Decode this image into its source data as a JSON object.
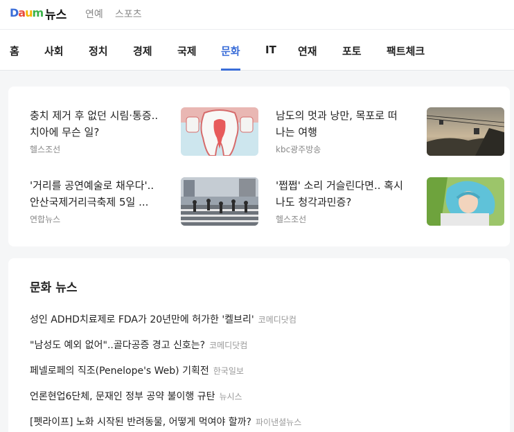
{
  "header": {
    "logo_text": "Daum",
    "service_name": "뉴스",
    "links": [
      "연예",
      "스포츠"
    ]
  },
  "nav": {
    "items": [
      "홈",
      "사회",
      "정치",
      "경제",
      "국제",
      "문화",
      "IT",
      "연재",
      "포토",
      "팩트체크"
    ],
    "active": "문화",
    "accent_color": "#3a6dd8"
  },
  "featured": [
    {
      "title_line1": "충치 제거 후 없던 시림·통증..",
      "title_line2": "치아에 무슨 일?",
      "source": "헬스조선",
      "thumb_icon": "tooth-illustration"
    },
    {
      "title_line1": "남도의 멋과 낭만, 목포로 떠",
      "title_line2": "나는 여행",
      "source": "kbc광주방송",
      "thumb_icon": "cable-car-photo"
    },
    {
      "title_line1": "'거리를 공연예술로 채우다'..",
      "title_line2": "안산국제거리극축제 5일 ...",
      "source": "연합뉴스",
      "thumb_icon": "street-crowd-photo"
    },
    {
      "title_line1": "'쩝쩝' 소리 거슬린다면.. 혹시",
      "title_line2": "나도 청각과민증?",
      "source": "헬스조선",
      "thumb_icon": "woman-covering-ears-photo"
    }
  ],
  "culture_news": {
    "title": "문화 뉴스",
    "items": [
      {
        "headline": "성인 ADHD치료제로 FDA가 20년만에 허가한 '켈브리'",
        "source": "코메디닷컴"
      },
      {
        "headline": "\"남성도 예외 없어\"..골다공증 경고 신호는?",
        "source": "코메디닷컴"
      },
      {
        "headline": "페넬로페의 직조(Penelope's Web) 기획전",
        "source": "한국일보"
      },
      {
        "headline": "언론현업6단체, 문재인 정부 공약 불이행 규탄",
        "source": "뉴시스"
      },
      {
        "headline": "[펫라이프] 노화 시작된 반려동물, 어떻게 먹여야 할까?",
        "source": "파이낸셜뉴스"
      }
    ]
  }
}
